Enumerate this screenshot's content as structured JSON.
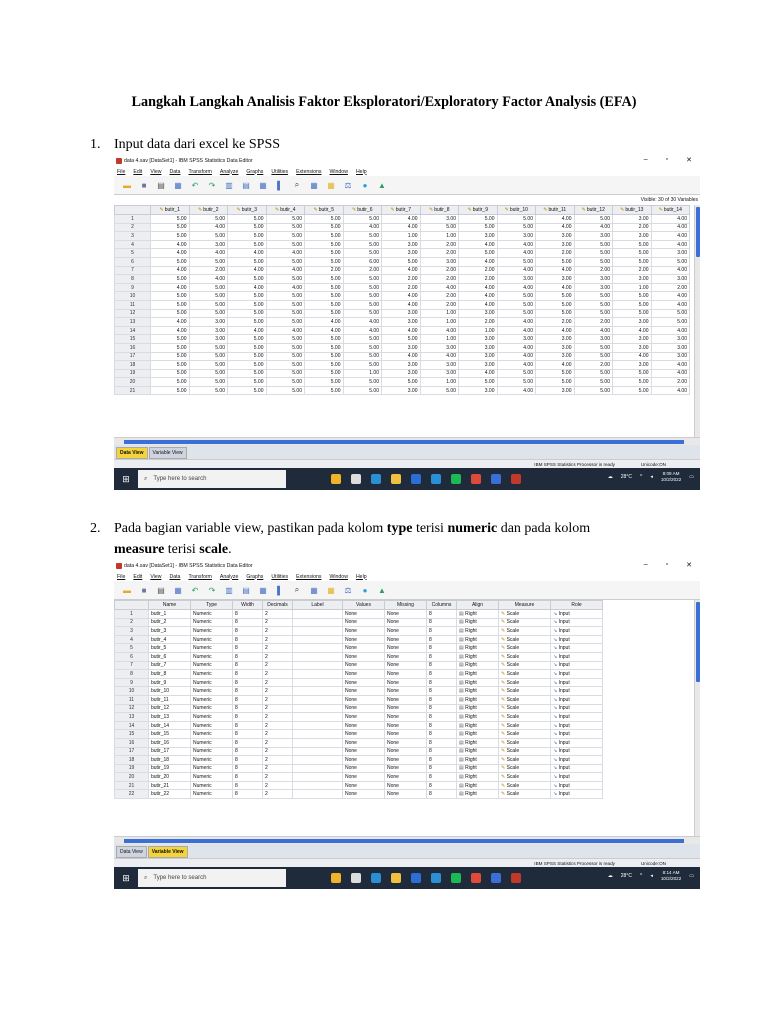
{
  "doc": {
    "title": "Langkah Langkah Analisis Faktor Eksploratori/Exploratory Factor Analysis (EFA)",
    "step1": {
      "num": "1.",
      "text": "Input data dari excel ke SPSS"
    },
    "step2": {
      "num": "2.",
      "line1_a": "Pada bagian variable view, pastikan pada kolom ",
      "line1_b": "type",
      "line1_c": " terisi ",
      "line1_d": "numeric",
      "line1_e": " dan pada kolom",
      "line2_a": "measure",
      "line2_b": " terisi ",
      "line2_c": "scale",
      "line2_d": "."
    }
  },
  "spss_common": {
    "menu": [
      "File",
      "Edit",
      "View",
      "Data",
      "Transform",
      "Analyze",
      "Graphs",
      "Utilities",
      "Extensions",
      "Window",
      "Help"
    ],
    "tab_data": "Data View",
    "tab_variable": "Variable View",
    "status_processor": "IBM SPSS Statistics Processor is ready",
    "status_unicode": "Unicode:ON",
    "search_placeholder": "Type here to search",
    "temperature": "28°C",
    "win_min": "–",
    "win_max": "▫",
    "win_close": "✕"
  },
  "data_view": {
    "window_title": "data 4.sav [DataSet1] - IBM SPSS Statistics Data Editor",
    "visible_label": "Visible: 30 of 30 Variables",
    "columns": [
      "butir_1",
      "butir_2",
      "butir_3",
      "butir_4",
      "butir_5",
      "butir_6",
      "butir_7",
      "butir_8",
      "butir_9",
      "butir_10",
      "butir_11",
      "butir_12",
      "butir_13",
      "butir_14"
    ],
    "rows": [
      [
        "1",
        "5.00",
        "5.00",
        "5.00",
        "5.00",
        "5.00",
        "5.00",
        "4.00",
        "3.00",
        "5.00",
        "5.00",
        "4.00",
        "5.00",
        "3.00",
        "4.00"
      ],
      [
        "2",
        "5.00",
        "4.00",
        "5.00",
        "5.00",
        "5.00",
        "4.00",
        "4.00",
        "5.00",
        "5.00",
        "5.00",
        "4.00",
        "4.00",
        "2.00",
        "4.00"
      ],
      [
        "3",
        "5.00",
        "5.00",
        "5.00",
        "5.00",
        "5.00",
        "5.00",
        "1.00",
        "1.00",
        "3.00",
        "3.00",
        "3.00",
        "3.00",
        "3.00",
        "4.00"
      ],
      [
        "4",
        "4.00",
        "3.00",
        "5.00",
        "5.00",
        "5.00",
        "5.00",
        "3.00",
        "2.00",
        "4.00",
        "4.00",
        "3.00",
        "5.00",
        "5.00",
        "4.00"
      ],
      [
        "5",
        "4.00",
        "4.00",
        "4.00",
        "4.00",
        "5.00",
        "5.00",
        "3.00",
        "2.00",
        "5.00",
        "4.00",
        "2.00",
        "5.00",
        "5.00",
        "3.00"
      ],
      [
        "6",
        "5.00",
        "5.00",
        "5.00",
        "5.00",
        "5.00",
        "6.00",
        "5.00",
        "3.00",
        "4.00",
        "5.00",
        "5.00",
        "5.00",
        "5.00",
        "5.00"
      ],
      [
        "7",
        "4.00",
        "2.00",
        "4.00",
        "4.00",
        "2.00",
        "2.00",
        "4.00",
        "2.00",
        "2.00",
        "4.00",
        "4.00",
        "2.00",
        "2.00",
        "4.00"
      ],
      [
        "8",
        "5.00",
        "4.00",
        "5.00",
        "5.00",
        "5.00",
        "5.00",
        "2.00",
        "2.00",
        "2.00",
        "3.00",
        "3.00",
        "3.00",
        "3.00",
        "3.00"
      ],
      [
        "9",
        "4.00",
        "5.00",
        "4.00",
        "4.00",
        "5.00",
        "5.00",
        "2.00",
        "4.00",
        "4.00",
        "4.00",
        "4.00",
        "3.00",
        "1.00",
        "2.00"
      ],
      [
        "10",
        "5.00",
        "5.00",
        "5.00",
        "5.00",
        "5.00",
        "5.00",
        "4.00",
        "2.00",
        "4.00",
        "5.00",
        "5.00",
        "5.00",
        "5.00",
        "4.00"
      ],
      [
        "11",
        "5.00",
        "5.00",
        "5.00",
        "5.00",
        "5.00",
        "5.00",
        "4.00",
        "2.00",
        "4.00",
        "5.00",
        "5.00",
        "5.00",
        "5.00",
        "4.00"
      ],
      [
        "12",
        "5.00",
        "5.00",
        "5.00",
        "5.00",
        "5.00",
        "5.00",
        "3.00",
        "1.00",
        "3.00",
        "5.00",
        "5.00",
        "5.00",
        "5.00",
        "5.00"
      ],
      [
        "13",
        "4.00",
        "3.00",
        "5.00",
        "5.00",
        "4.00",
        "4.00",
        "3.00",
        "1.00",
        "2.00",
        "4.00",
        "2.00",
        "2.00",
        "3.00",
        "5.00"
      ],
      [
        "14",
        "4.00",
        "3.00",
        "4.00",
        "4.00",
        "4.00",
        "4.00",
        "4.00",
        "4.00",
        "1.00",
        "4.00",
        "4.00",
        "4.00",
        "4.00",
        "4.00"
      ],
      [
        "15",
        "5.00",
        "3.00",
        "5.00",
        "5.00",
        "5.00",
        "5.00",
        "5.00",
        "1.00",
        "3.00",
        "3.00",
        "3.00",
        "3.00",
        "3.00",
        "3.00"
      ],
      [
        "16",
        "5.00",
        "5.00",
        "5.00",
        "5.00",
        "5.00",
        "5.00",
        "3.00",
        "3.00",
        "3.00",
        "4.00",
        "3.00",
        "5.00",
        "3.00",
        "3.00"
      ],
      [
        "17",
        "5.00",
        "5.00",
        "5.00",
        "5.00",
        "5.00",
        "5.00",
        "4.00",
        "4.00",
        "3.00",
        "4.00",
        "3.00",
        "5.00",
        "4.00",
        "3.00"
      ],
      [
        "18",
        "5.00",
        "5.00",
        "5.00",
        "5.00",
        "5.00",
        "5.00",
        "3.00",
        "3.00",
        "3.00",
        "4.00",
        "4.00",
        "2.00",
        "3.00",
        "4.00"
      ],
      [
        "19",
        "5.00",
        "5.00",
        "5.00",
        "5.00",
        "5.00",
        "1.00",
        "3.00",
        "3.00",
        "4.00",
        "5.00",
        "5.00",
        "5.00",
        "5.00",
        "4.00"
      ],
      [
        "20",
        "5.00",
        "5.00",
        "5.00",
        "5.00",
        "5.00",
        "5.00",
        "5.00",
        "1.00",
        "5.00",
        "5.00",
        "5.00",
        "5.00",
        "5.00",
        "2.00"
      ],
      [
        "21",
        "5.00",
        "5.00",
        "5.00",
        "5.00",
        "5.00",
        "5.00",
        "3.00",
        "5.00",
        "3.00",
        "4.00",
        "3.00",
        "5.00",
        "5.00",
        "4.00"
      ]
    ],
    "clock_time": "8:09 AM",
    "clock_date": "10/2/2022"
  },
  "variable_view": {
    "window_title": "data 4.sav [DataSet1] - IBM SPSS Statistics Data Editor",
    "headers": [
      "",
      "Name",
      "Type",
      "Width",
      "Decimals",
      "Label",
      "Values",
      "Missing",
      "Columns",
      "Align",
      "Measure",
      "Role"
    ],
    "type_value": "Numeric",
    "width_value": "8",
    "decimals_value": "2",
    "values_value": "None",
    "missing_value": "None",
    "columns_value": "8",
    "align_value": "Right",
    "measure_value": "Scale",
    "role_value": "Input",
    "names": [
      "butir_1",
      "butir_2",
      "butir_3",
      "butir_4",
      "butir_5",
      "butir_6",
      "butir_7",
      "butir_8",
      "butir_9",
      "butir_10",
      "butir_11",
      "butir_12",
      "butir_13",
      "butir_14",
      "butir_15",
      "butir_16",
      "butir_17",
      "butir_18",
      "butir_19",
      "butir_20",
      "butir_21",
      "butir_22"
    ],
    "clock_time": "8:14 AM",
    "clock_date": "10/2/2022"
  }
}
